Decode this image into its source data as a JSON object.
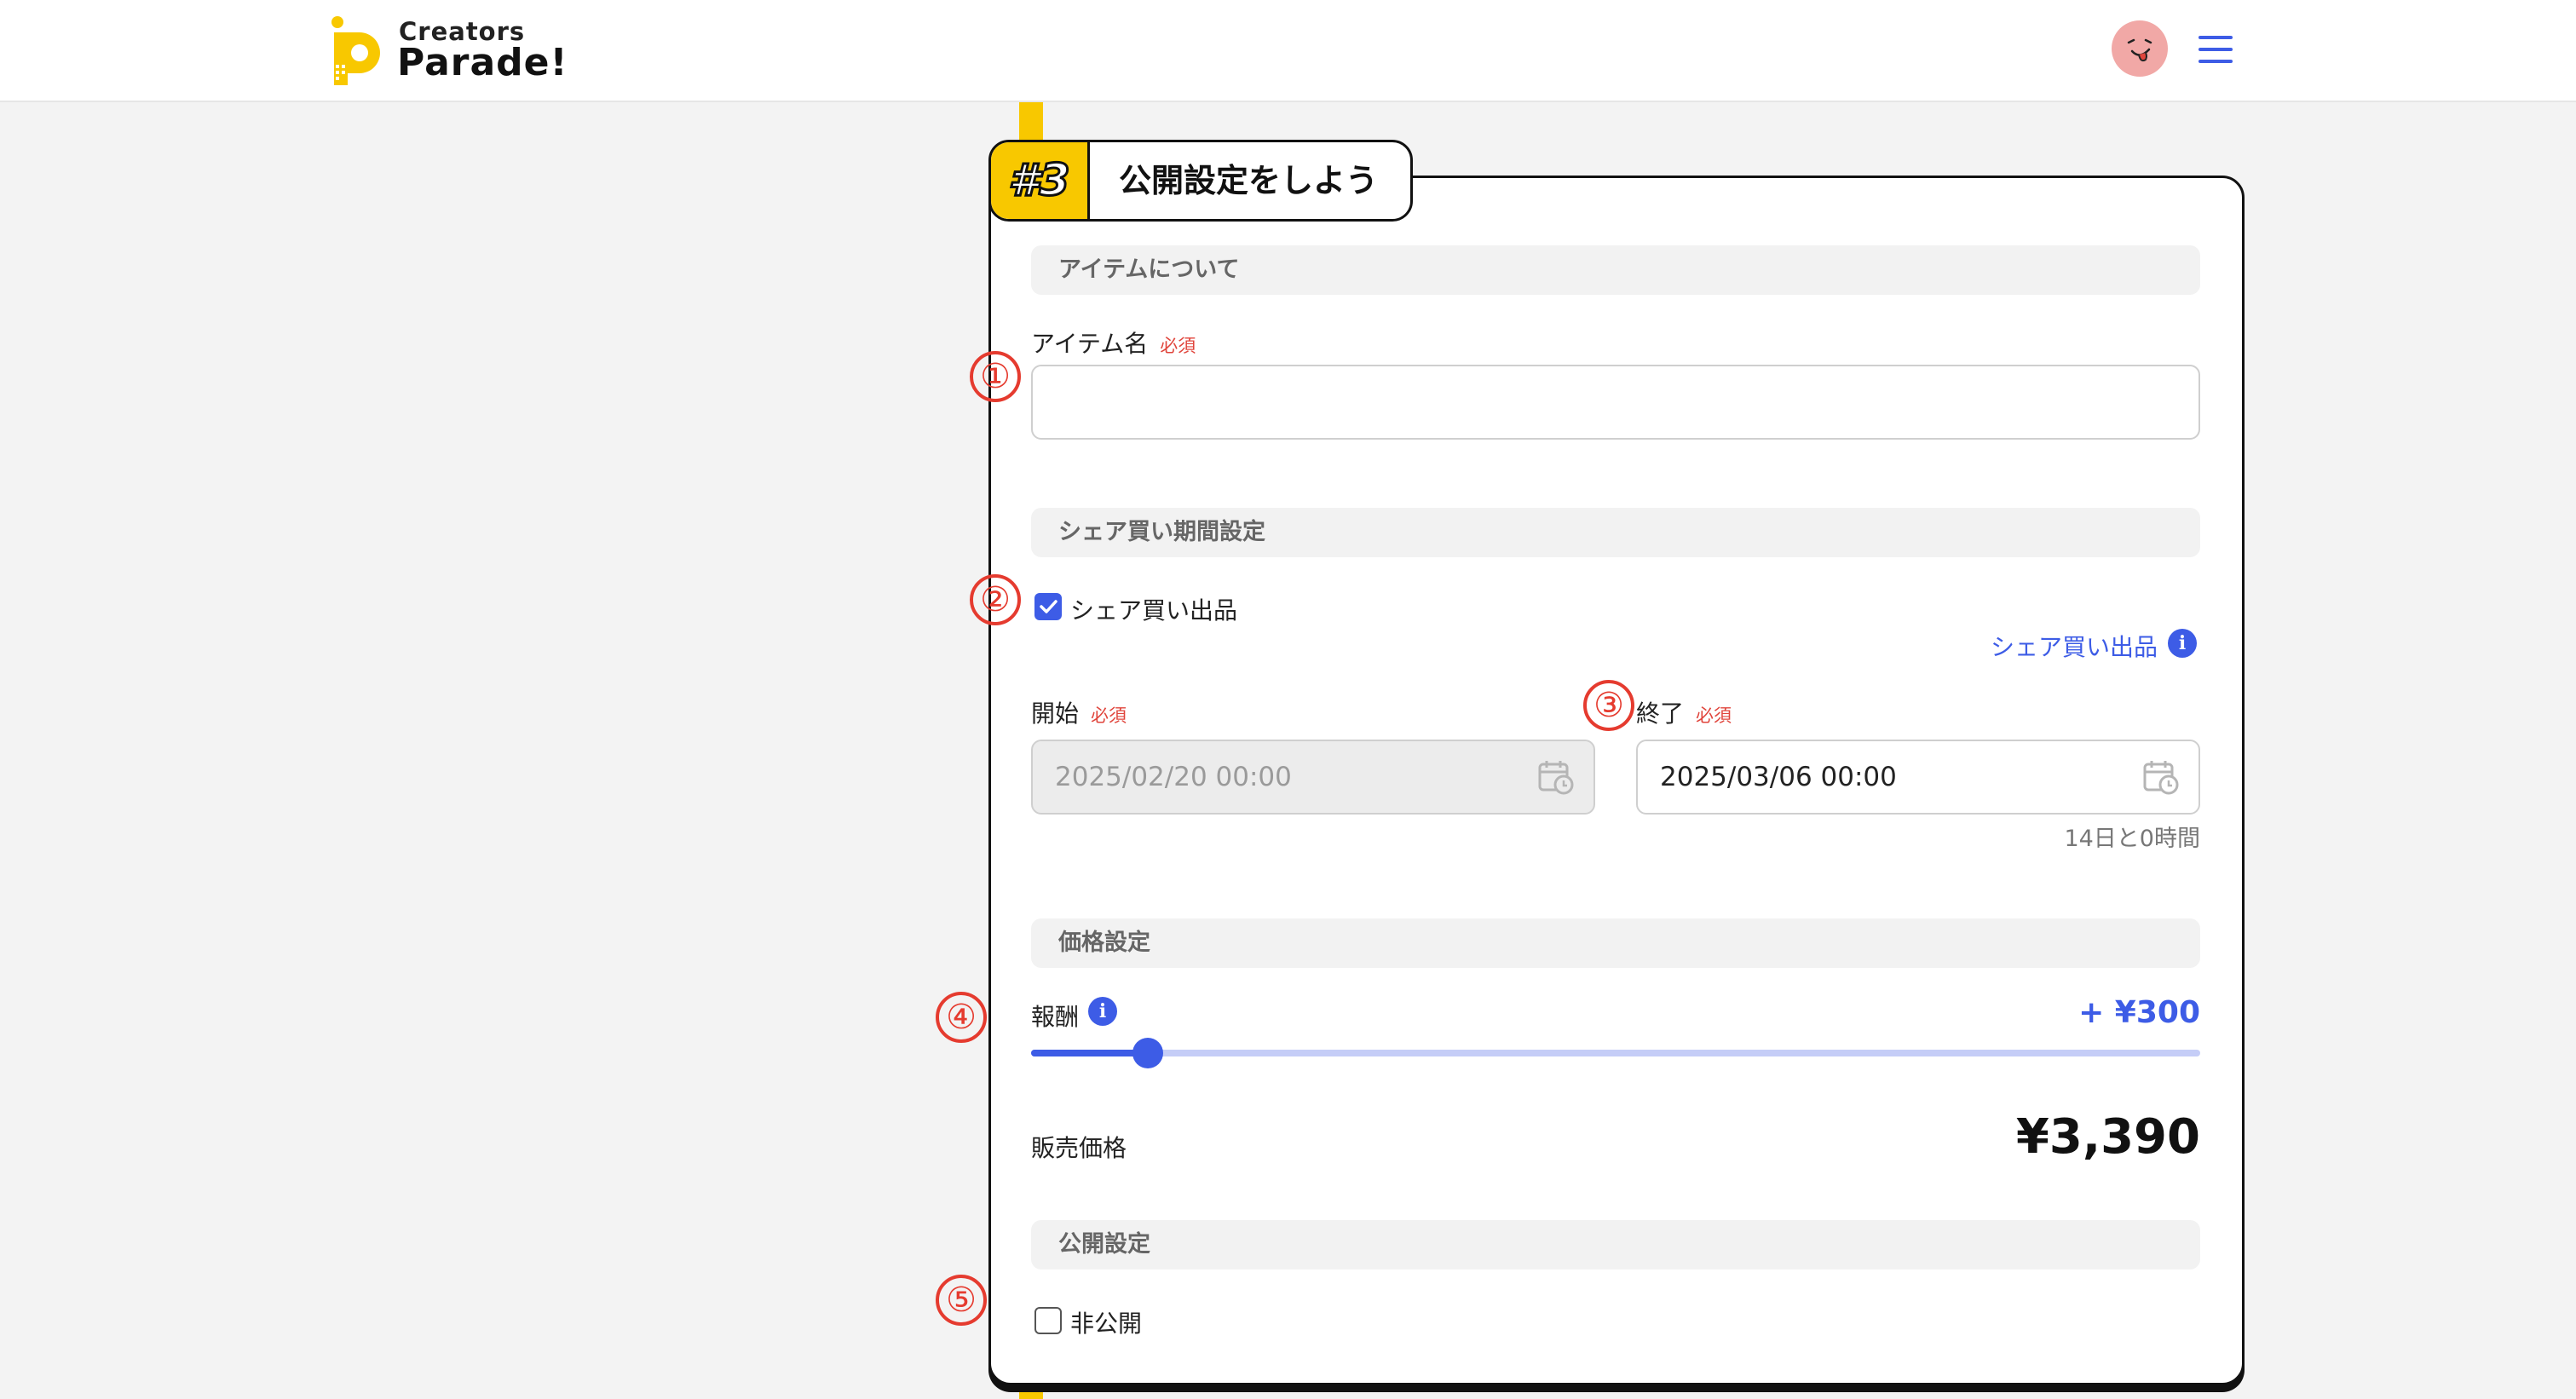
{
  "header": {
    "logo_top": "Creators",
    "logo_bottom": "Parade!",
    "avatar_icon": "smiley-tongue-avatar",
    "menu_icon": "hamburger-menu-icon"
  },
  "step": {
    "number": "#3",
    "title": "公開設定をしよう"
  },
  "sections": {
    "item": "アイテムについて",
    "share": "シェア買い期間設定",
    "price": "価格設定",
    "publish": "公開設定"
  },
  "markers": [
    "①",
    "②",
    "③",
    "④",
    "⑤"
  ],
  "item_name": {
    "label": "アイテム名",
    "required": "必須",
    "value": ""
  },
  "share_buy": {
    "checkbox_label": "シェア買い出品",
    "checked": true,
    "link_label": "シェア買い出品",
    "start_label": "開始",
    "start_required": "必須",
    "start_value": "2025/02/20 00:00",
    "end_label": "終了",
    "end_required": "必須",
    "end_value": "2025/03/06 00:00",
    "duration": "14日と0時間"
  },
  "price": {
    "reward_label": "報酬",
    "reward_value": "+ ¥300",
    "slider_fraction": 0.1,
    "sale_label": "販売価格",
    "sale_value": "¥3,390"
  },
  "publish": {
    "private_label": "非公開",
    "checked": false
  },
  "colors": {
    "accent": "#3d5ce6",
    "brand_yellow": "#f8c800",
    "required_red": "#e0453c",
    "marker_red": "#e53b2f"
  }
}
